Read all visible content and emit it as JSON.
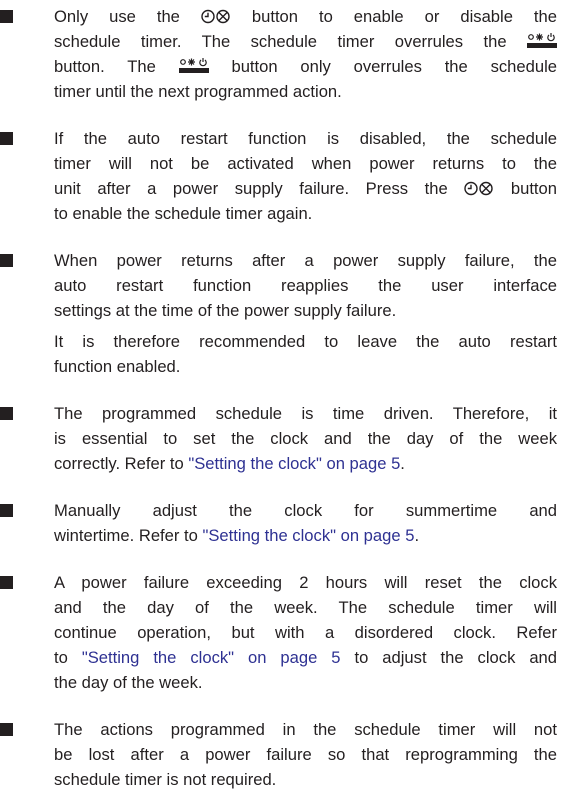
{
  "items": [
    {
      "lines": [
        {
          "parts": [
            {
              "t": "Only use the "
            },
            {
              "icon": "timer-onoff-icon"
            },
            {
              "t": " button to enable or disable the"
            }
          ]
        },
        {
          "parts": [
            {
              "t": "schedule timer. The schedule timer overrules the "
            },
            {
              "icon": "onoff-button-icon"
            }
          ]
        },
        {
          "parts": [
            {
              "t": "button. The "
            },
            {
              "icon": "onoff-button-icon"
            },
            {
              "t": " button only overrules the schedule"
            }
          ]
        },
        {
          "parts": [
            {
              "t": "timer until the next programmed action."
            }
          ],
          "last": true
        }
      ]
    },
    {
      "lines": [
        {
          "parts": [
            {
              "t": "If the auto restart function is disabled, the schedule"
            }
          ]
        },
        {
          "parts": [
            {
              "t": "timer will not be activated when power returns to the"
            }
          ]
        },
        {
          "parts": [
            {
              "t": "unit after a power supply failure. Press the "
            },
            {
              "icon": "timer-onoff-icon"
            },
            {
              "t": " button"
            }
          ]
        },
        {
          "parts": [
            {
              "t": "to enable the schedule timer again."
            }
          ],
          "last": true
        }
      ]
    },
    {
      "lines": [
        {
          "parts": [
            {
              "t": "When power returns after a power supply failure, the"
            }
          ]
        },
        {
          "parts": [
            {
              "t": "auto restart function reapplies the user interface"
            }
          ]
        },
        {
          "parts": [
            {
              "t": "settings at the time of the power supply failure."
            }
          ],
          "last": true
        },
        {
          "parts": [],
          "gap": true
        },
        {
          "parts": [
            {
              "t": "It is therefore recommended to leave the auto restart"
            }
          ]
        },
        {
          "parts": [
            {
              "t": "function enabled."
            }
          ],
          "last": true
        }
      ]
    },
    {
      "lines": [
        {
          "parts": [
            {
              "t": "The programmed schedule is time driven. Therefore, it"
            }
          ]
        },
        {
          "parts": [
            {
              "t": "is essential to set the clock and the day of the week"
            }
          ]
        },
        {
          "parts": [
            {
              "t": "correctly. Refer to "
            },
            {
              "link": "\"Setting the clock\" on page 5"
            },
            {
              "t": "."
            }
          ],
          "last": true
        }
      ]
    },
    {
      "lines": [
        {
          "parts": [
            {
              "t": "Manually adjust the clock for summertime and"
            }
          ]
        },
        {
          "parts": [
            {
              "t": "wintertime. Refer to "
            },
            {
              "link": "\"Setting the clock\" on page 5"
            },
            {
              "t": "."
            }
          ],
          "last": true
        }
      ]
    },
    {
      "lines": [
        {
          "parts": [
            {
              "t": "A power failure exceeding 2 hours will reset the clock"
            }
          ]
        },
        {
          "parts": [
            {
              "t": "and the day of the week. The schedule timer will"
            }
          ]
        },
        {
          "parts": [
            {
              "t": "continue operation, but with a disordered clock. Refer"
            }
          ]
        },
        {
          "parts": [
            {
              "t": "to "
            },
            {
              "link": "\"Setting the clock\" on page 5"
            },
            {
              "t": " to adjust the clock and"
            }
          ]
        },
        {
          "parts": [
            {
              "t": "the day of the week."
            }
          ],
          "last": true
        }
      ]
    },
    {
      "lines": [
        {
          "parts": [
            {
              "t": "The actions programmed in the schedule timer will not"
            }
          ]
        },
        {
          "parts": [
            {
              "t": "be lost after a power failure so that reprogramming the"
            }
          ]
        },
        {
          "parts": [
            {
              "t": "schedule timer is not required."
            }
          ],
          "last": true
        }
      ]
    }
  ]
}
